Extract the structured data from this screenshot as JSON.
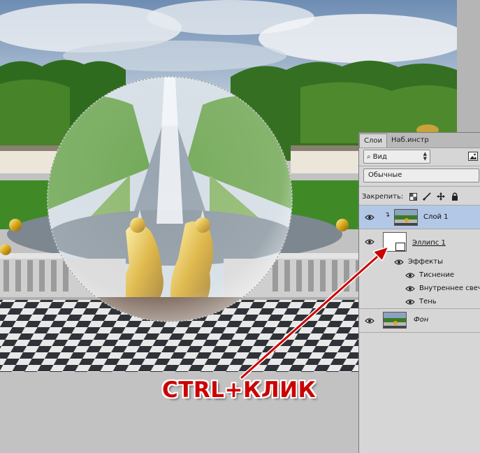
{
  "panel": {
    "tabs": [
      "Слои",
      "Наб.инстр"
    ],
    "filter_label": "Вид",
    "blend_mode": "Обычные",
    "lock_label": "Закрепить:"
  },
  "layers": [
    {
      "name": "Слой 1",
      "selected": true
    },
    {
      "name": "Эллипс 1",
      "selected": false
    },
    {
      "name": "Фон",
      "selected": false
    }
  ],
  "effects": {
    "group_label": "Эффекты",
    "items": [
      "Тиснение",
      "Внутреннее свечение",
      "Тень"
    ]
  },
  "annotation": {
    "text": "CTRL+КЛИК",
    "color": "#cc0000"
  },
  "icons": {
    "search": "search-icon",
    "eye": "eye-icon",
    "lock_pixels": "lock-transparent-pixels-icon",
    "lock_brush": "lock-image-pixels-icon",
    "lock_position": "lock-position-icon",
    "lock_all": "lock-all-icon"
  }
}
